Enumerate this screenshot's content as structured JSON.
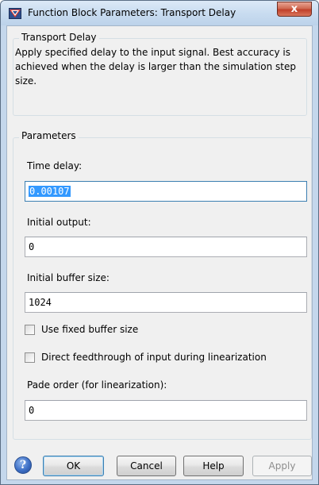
{
  "window": {
    "title": "Function Block Parameters: Transport Delay",
    "close_symbol": "x"
  },
  "block_group": {
    "legend": "Transport Delay",
    "description": "Apply specified delay to the input signal.  Best accuracy is achieved when the delay is larger than the simulation step size."
  },
  "params_group": {
    "legend": "Parameters",
    "time_delay": {
      "label": "Time delay:",
      "value": "0.00107"
    },
    "initial_output": {
      "label": "Initial output:",
      "value": "0"
    },
    "initial_buffer": {
      "label": "Initial buffer size:",
      "value": "1024"
    },
    "use_fixed_buffer": {
      "label": "Use fixed buffer size",
      "checked": false
    },
    "direct_feedthrough": {
      "label": "Direct feedthrough of input during linearization",
      "checked": false
    },
    "pade_order": {
      "label": "Pade order (for linearization):",
      "value": "0"
    }
  },
  "buttons": {
    "help_icon": "?",
    "ok": "OK",
    "cancel": "Cancel",
    "help": "Help",
    "apply": "Apply"
  },
  "colors": {
    "titlebar": "#c9dcf0",
    "client_bg": "#f0f0f0",
    "selection": "#3399ff",
    "close_button": "#c0402a"
  },
  "icons": [
    "simulink-block-icon",
    "close-icon",
    "help-icon"
  ]
}
